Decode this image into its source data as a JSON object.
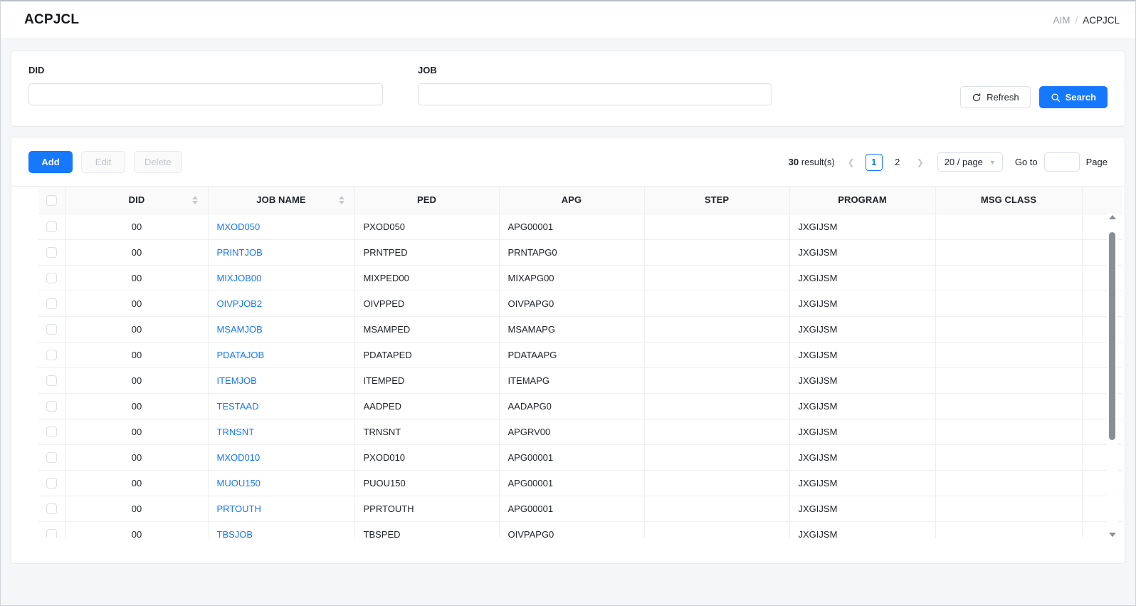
{
  "header": {
    "app_title": "ACPJCL",
    "breadcrumb": {
      "root": "AIM",
      "separator": "/",
      "current": "ACPJCL"
    }
  },
  "search": {
    "did": {
      "label": "DID",
      "value": "",
      "placeholder": ""
    },
    "job": {
      "label": "JOB",
      "value": "",
      "placeholder": ""
    },
    "refresh_label": "Refresh",
    "refresh_icon": "reload-icon",
    "search_label": "Search",
    "search_icon": "search-icon"
  },
  "toolbar": {
    "add_label": "Add",
    "edit_label": "Edit",
    "delete_label": "Delete"
  },
  "pagination": {
    "total_count": "30",
    "total_suffix": " result(s)",
    "prev_icon": "chevron-left-icon",
    "next_icon": "chevron-right-icon",
    "pages": [
      "1",
      "2"
    ],
    "active_page": "1",
    "page_size_label": "20 / page",
    "goto_label": "Go to",
    "goto_value": "",
    "page_label": "Page"
  },
  "table": {
    "columns": [
      {
        "key": "did",
        "label": "DID",
        "sortable": true
      },
      {
        "key": "job_name",
        "label": "JOB NAME",
        "sortable": true
      },
      {
        "key": "ped",
        "label": "PED",
        "sortable": false
      },
      {
        "key": "apg",
        "label": "APG",
        "sortable": false
      },
      {
        "key": "step",
        "label": "STEP",
        "sortable": false
      },
      {
        "key": "program",
        "label": "PROGRAM",
        "sortable": false
      },
      {
        "key": "msg_class",
        "label": "MSG CLASS",
        "sortable": false
      }
    ],
    "rows": [
      {
        "did": "00",
        "job_name": "MXOD050",
        "ped": "PXOD050",
        "apg": "APG00001",
        "step": "",
        "program": "JXGIJSM",
        "msg_class": ""
      },
      {
        "did": "00",
        "job_name": "PRINTJOB",
        "ped": "PRNTPED",
        "apg": "PRNTAPG0",
        "step": "",
        "program": "JXGIJSM",
        "msg_class": ""
      },
      {
        "did": "00",
        "job_name": "MIXJOB00",
        "ped": "MIXPED00",
        "apg": "MIXAPG00",
        "step": "",
        "program": "JXGIJSM",
        "msg_class": ""
      },
      {
        "did": "00",
        "job_name": "OIVPJOB2",
        "ped": "OIVPPED",
        "apg": "OIVPAPG0",
        "step": "",
        "program": "JXGIJSM",
        "msg_class": ""
      },
      {
        "did": "00",
        "job_name": "MSAMJOB",
        "ped": "MSAMPED",
        "apg": "MSAMAPG",
        "step": "",
        "program": "JXGIJSM",
        "msg_class": ""
      },
      {
        "did": "00",
        "job_name": "PDATAJOB",
        "ped": "PDATAPED",
        "apg": "PDATAAPG",
        "step": "",
        "program": "JXGIJSM",
        "msg_class": ""
      },
      {
        "did": "00",
        "job_name": "ITEMJOB",
        "ped": "ITEMPED",
        "apg": "ITEMAPG",
        "step": "",
        "program": "JXGIJSM",
        "msg_class": ""
      },
      {
        "did": "00",
        "job_name": "TESTAAD",
        "ped": "AADPED",
        "apg": "AADAPG0",
        "step": "",
        "program": "JXGIJSM",
        "msg_class": ""
      },
      {
        "did": "00",
        "job_name": "TRNSNT",
        "ped": "TRNSNT",
        "apg": "APGRV00",
        "step": "",
        "program": "JXGIJSM",
        "msg_class": ""
      },
      {
        "did": "00",
        "job_name": "MXOD010",
        "ped": "PXOD010",
        "apg": "APG00001",
        "step": "",
        "program": "JXGIJSM",
        "msg_class": ""
      },
      {
        "did": "00",
        "job_name": "MUOU150",
        "ped": "PUOU150",
        "apg": "APG00001",
        "step": "",
        "program": "JXGIJSM",
        "msg_class": ""
      },
      {
        "did": "00",
        "job_name": "PRTOUTH",
        "ped": "PPRTOUTH",
        "apg": "APG00001",
        "step": "",
        "program": "JXGIJSM",
        "msg_class": ""
      },
      {
        "did": "00",
        "job_name": "TBSJOB",
        "ped": "TBSPED",
        "apg": "OIVPAPG0",
        "step": "",
        "program": "JXGIJSM",
        "msg_class": ""
      }
    ]
  },
  "colors": {
    "accent": "#1677ff",
    "link": "#1677ff",
    "page_bg": "#f4f6f8",
    "card_bg": "#ffffff",
    "header_row_bg": "#fafafa",
    "border": "#eceef1"
  }
}
